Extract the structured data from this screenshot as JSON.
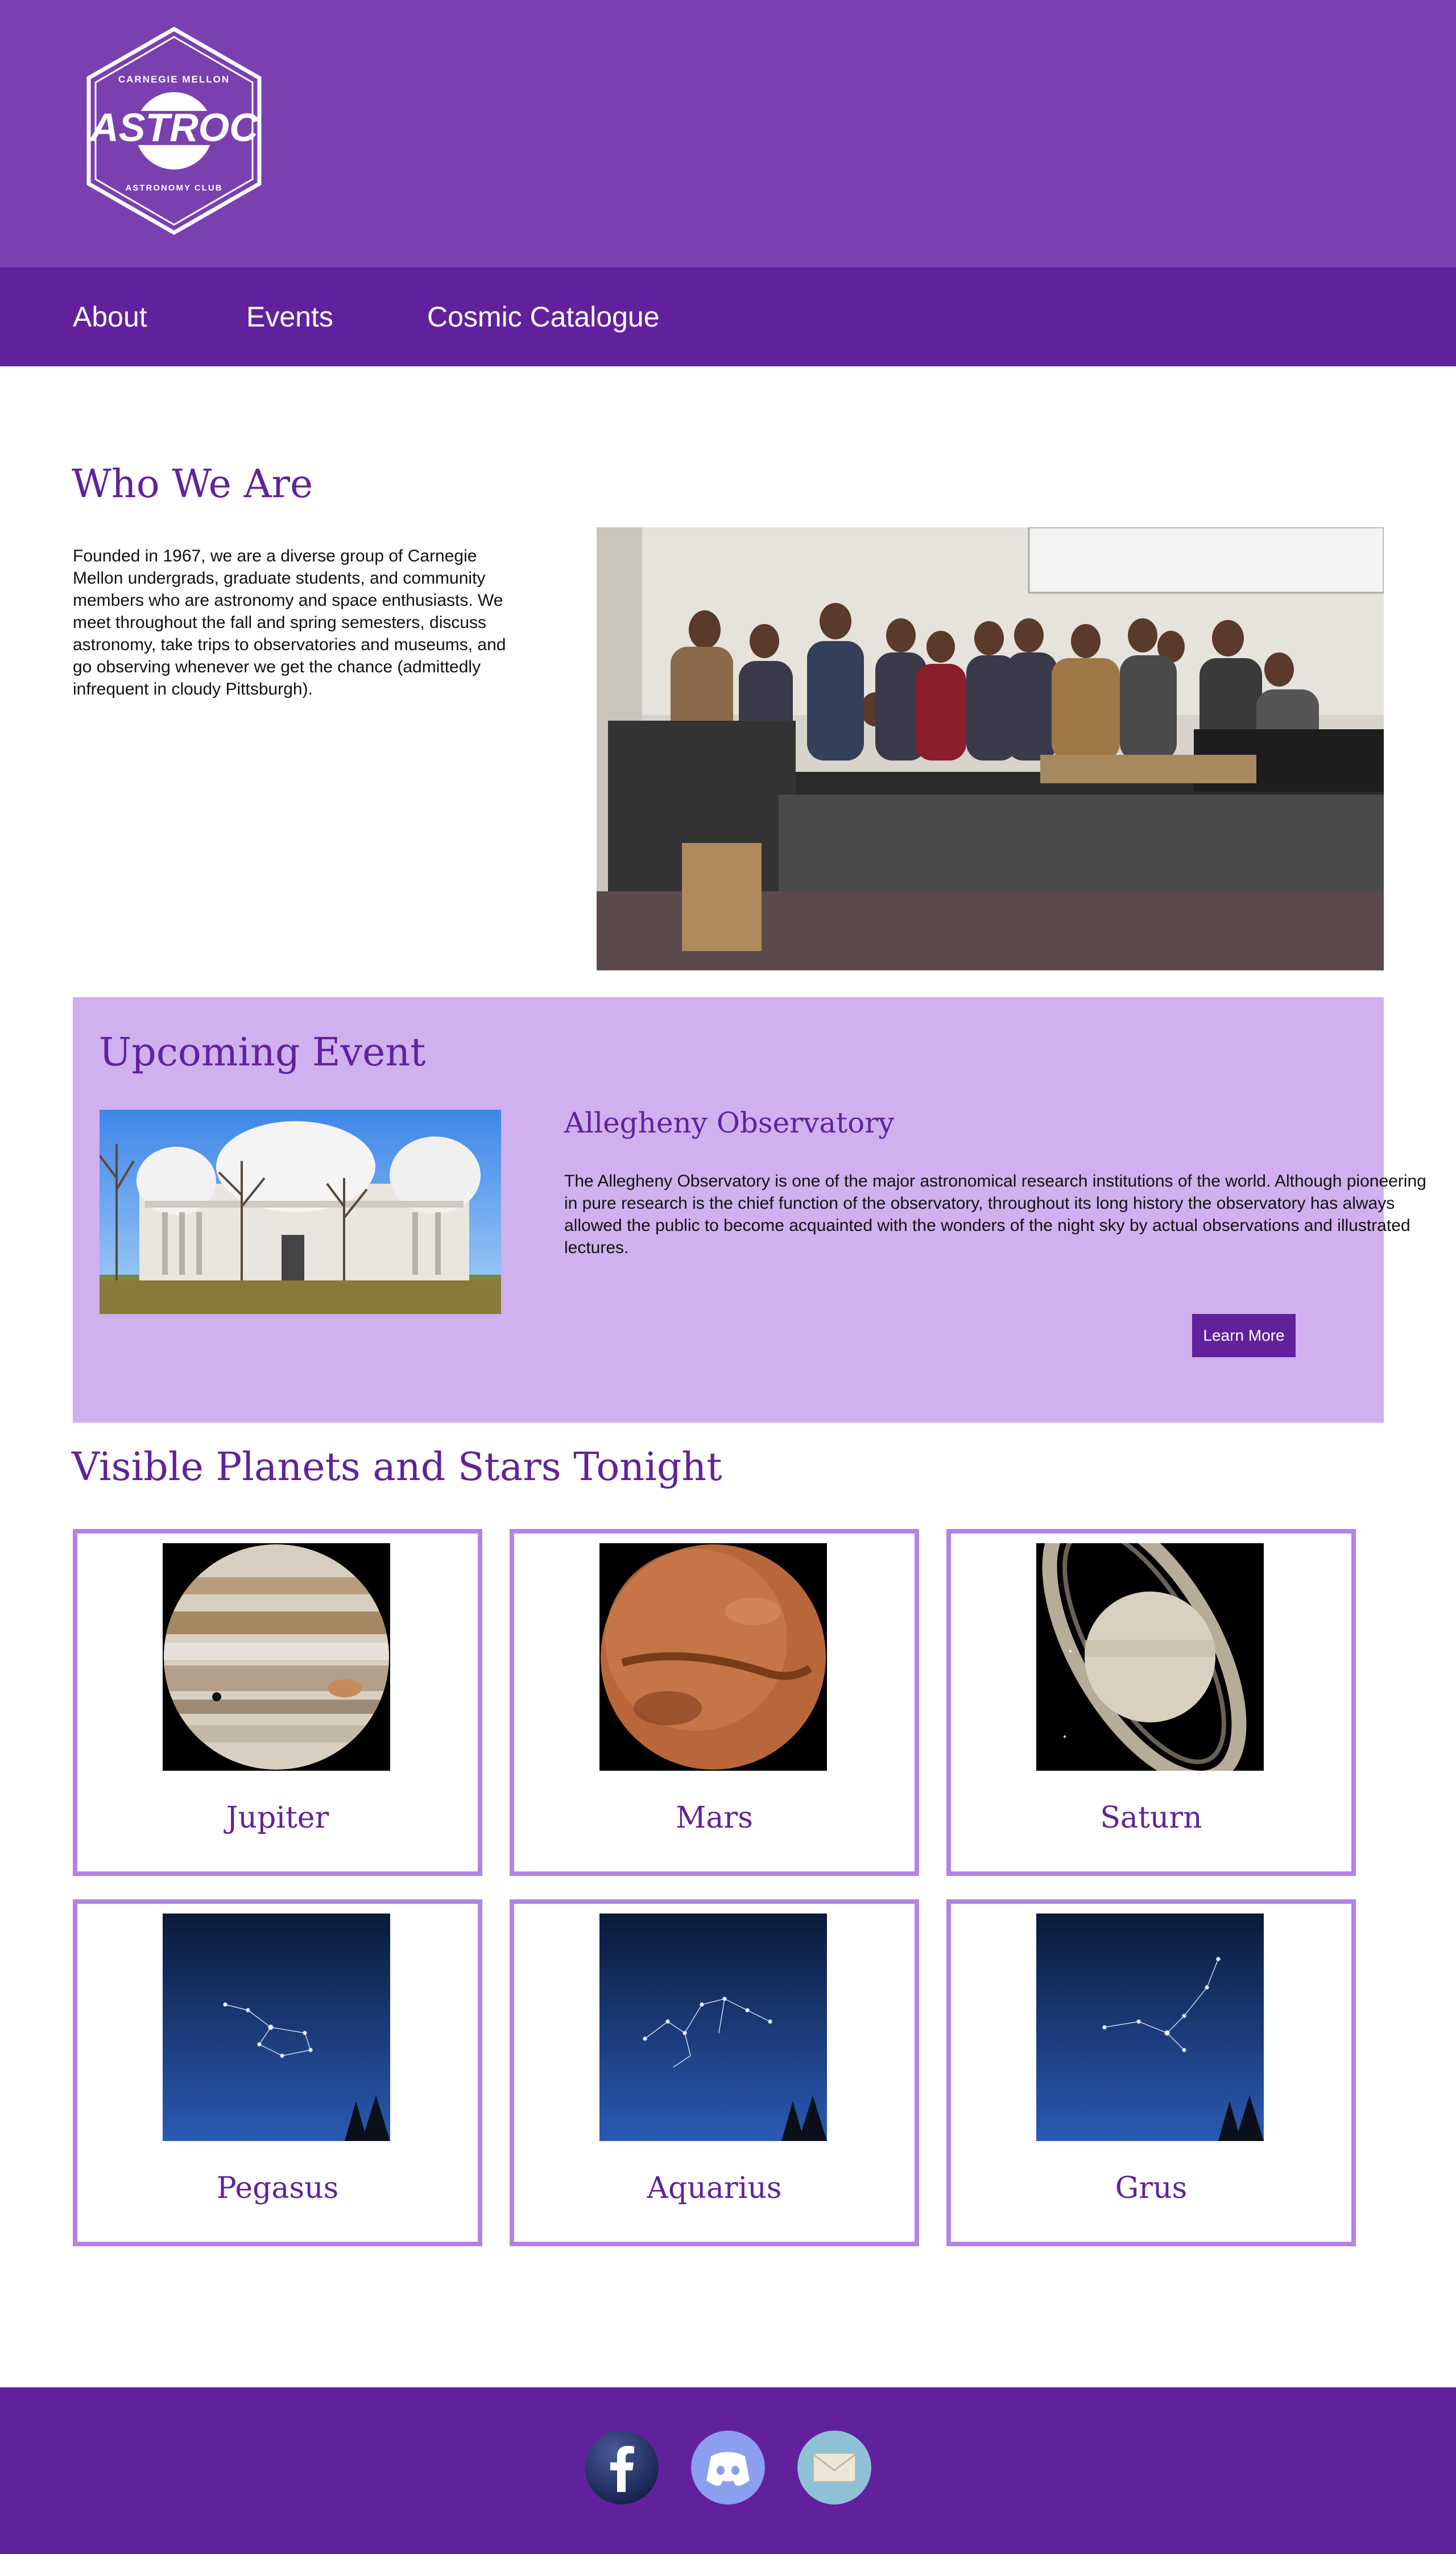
{
  "header": {
    "logo": {
      "top_text": "CARNEGIE MELLON",
      "main_text": "ASTROC",
      "bottom_text": "ASTRONOMY CLUB"
    },
    "nav": [
      "About",
      "Events",
      "Cosmic Catalogue"
    ]
  },
  "about": {
    "title": "Who We Are",
    "text": "Founded in 1967, we are a diverse group of Carnegie Mellon undergrads, graduate students, and community members who are astronomy and space enthusiasts. We meet throughout the fall and spring semesters, discuss astronomy, take trips to observatories and museums, and go observing whenever we get the chance (admittedly infrequent in cloudy Pittsburgh)."
  },
  "event": {
    "title": "Upcoming Event",
    "name": "Allegheny Observatory",
    "description": "The Allegheny Observatory is one of the major astronomical research institutions of the world. Although pioneering in pure research is the chief function of the observatory, throughout its long history the observatory has always allowed the public to become acquainted with the wonders of the night sky by actual observations and illustrated lectures.",
    "button": "Learn More"
  },
  "sky": {
    "title": "Visible Planets and Stars Tonight",
    "items": [
      {
        "name": "Jupiter",
        "icon": "jupiter-image"
      },
      {
        "name": "Mars",
        "icon": "mars-image"
      },
      {
        "name": "Saturn",
        "icon": "saturn-image"
      },
      {
        "name": "Pegasus",
        "icon": "constellation-image"
      },
      {
        "name": "Aquarius",
        "icon": "constellation-image"
      },
      {
        "name": "Grus",
        "icon": "constellation-image"
      }
    ]
  },
  "footer": {
    "social": [
      {
        "name": "facebook",
        "icon": "facebook-icon"
      },
      {
        "name": "discord",
        "icon": "discord-icon"
      },
      {
        "name": "email",
        "icon": "email-icon"
      }
    ]
  },
  "colors": {
    "banner": "#7a40b0",
    "nav": "#62219c",
    "heading": "#62219c",
    "event_bg": "#d0b0ee",
    "card_border": "#b284e6"
  }
}
